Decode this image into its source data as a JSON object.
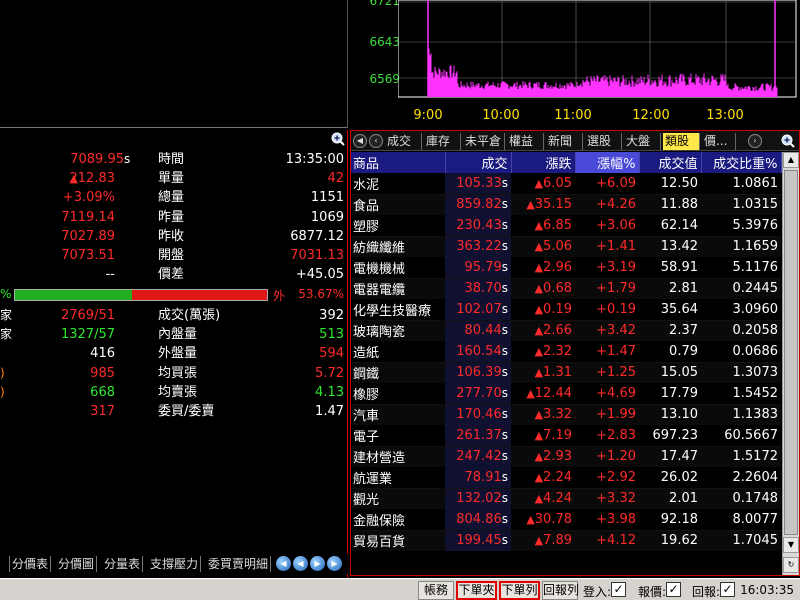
{
  "chart": {
    "y_labels": [
      "6721",
      "6643",
      "6569"
    ],
    "x_labels": [
      "9:00",
      "10:00",
      "11:00",
      "12:00",
      "13:00"
    ],
    "colors": {
      "bars": "#ff33ff",
      "grid": "#777777",
      "axis_text_y": "#3fdc3f",
      "axis_text_x": "#ffe000"
    }
  },
  "quote": {
    "rows": [
      {
        "left": "7089.95",
        "left_suffix": "s",
        "left_color": "red",
        "label": "時間",
        "right": "13:35:00",
        "right_color": "white"
      },
      {
        "left": "212.83",
        "left_prefix": "▲",
        "left_color": "red",
        "label": "單量",
        "right": "42",
        "right_color": "red"
      },
      {
        "left": "+3.09%",
        "left_color": "red",
        "label": "總量",
        "right": "1151",
        "right_color": "white"
      },
      {
        "left": "7119.14",
        "left_color": "red",
        "label": "昨量",
        "right": "1069",
        "right_color": "white"
      },
      {
        "left": "7027.89",
        "left_color": "red",
        "label": "昨收",
        "right": "6877.12",
        "right_color": "white"
      },
      {
        "left": "7073.51",
        "left_color": "red",
        "label": "開盤",
        "right": "7031.13",
        "right_color": "red"
      },
      {
        "left": "--",
        "left_color": "white",
        "label": "價差",
        "right": "+45.05",
        "right_color": "white"
      }
    ],
    "ratio": {
      "left_pct": "%",
      "green_fraction": 0.4633,
      "out_label": "外",
      "right_pct": "53.67%"
    },
    "rows2": [
      {
        "prefix": "家",
        "left": "2769/51",
        "left_color": "red",
        "label": "成交(萬張)",
        "right": "392",
        "right_color": "white"
      },
      {
        "prefix": "家",
        "left": "1327/57",
        "left_color": "green",
        "label": "內盤量",
        "right": "513",
        "right_color": "green"
      },
      {
        "prefix": "",
        "left": "416",
        "left_color": "white",
        "label": "外盤量",
        "right": "594",
        "right_color": "red"
      },
      {
        "prefix": ")",
        "left": "985",
        "left_color": "red",
        "label": "均買張",
        "right": "5.72",
        "right_color": "red"
      },
      {
        "prefix": ")",
        "left": "668",
        "left_color": "green",
        "label": "均賣張",
        "right": "4.13",
        "right_color": "green"
      },
      {
        "prefix": "",
        "left": "317",
        "left_color": "red",
        "label": "委買/委賣",
        "right": "1.47",
        "right_color": "white"
      }
    ],
    "bottom_tabs": [
      "分價表",
      "分價圖",
      "分量表",
      "支撐壓力",
      "委買賣明細"
    ]
  },
  "sector": {
    "tabs": [
      "成交",
      "庫存",
      "未平倉",
      "權益",
      "新聞",
      "選股",
      "大盤",
      "類股",
      "價..."
    ],
    "active_tab": "類股",
    "headers": [
      "商品",
      "成交",
      "漲跌",
      "漲幅%",
      "成交值",
      "成交比重%"
    ],
    "highlight_header": "漲幅%",
    "rows": [
      {
        "name": "水泥",
        "price": "105.33",
        "chg": "6.05",
        "pct": "+6.09",
        "vol": "12.50",
        "ratio": "1.0861"
      },
      {
        "name": "食品",
        "price": "859.82",
        "chg": "35.15",
        "pct": "+4.26",
        "vol": "11.88",
        "ratio": "1.0315"
      },
      {
        "name": "塑膠",
        "price": "230.43",
        "chg": "6.85",
        "pct": "+3.06",
        "vol": "62.14",
        "ratio": "5.3976"
      },
      {
        "name": "紡織纖維",
        "price": "363.22",
        "chg": "5.06",
        "pct": "+1.41",
        "vol": "13.42",
        "ratio": "1.1659"
      },
      {
        "name": "電機機械",
        "price": "95.79",
        "chg": "2.96",
        "pct": "+3.19",
        "vol": "58.91",
        "ratio": "5.1176"
      },
      {
        "name": "電器電纜",
        "price": "38.70",
        "chg": "0.68",
        "pct": "+1.79",
        "vol": "2.81",
        "ratio": "0.2445"
      },
      {
        "name": "化學生技醫療",
        "price": "102.07",
        "chg": "0.19",
        "pct": "+0.19",
        "vol": "35.64",
        "ratio": "3.0960"
      },
      {
        "name": "玻璃陶瓷",
        "price": "80.44",
        "chg": "2.66",
        "pct": "+3.42",
        "vol": "2.37",
        "ratio": "0.2058"
      },
      {
        "name": "造紙",
        "price": "160.54",
        "chg": "2.32",
        "pct": "+1.47",
        "vol": "0.79",
        "ratio": "0.0686"
      },
      {
        "name": "鋼鐵",
        "price": "106.39",
        "chg": "1.31",
        "pct": "+1.25",
        "vol": "15.05",
        "ratio": "1.3073"
      },
      {
        "name": "橡膠",
        "price": "277.70",
        "chg": "12.44",
        "pct": "+4.69",
        "vol": "17.79",
        "ratio": "1.5452"
      },
      {
        "name": "汽車",
        "price": "170.46",
        "chg": "3.32",
        "pct": "+1.99",
        "vol": "13.10",
        "ratio": "1.1383"
      },
      {
        "name": "電子",
        "price": "261.37",
        "chg": "7.19",
        "pct": "+2.83",
        "vol": "697.23",
        "ratio": "60.5667"
      },
      {
        "name": "建材營造",
        "price": "247.42",
        "chg": "2.93",
        "pct": "+1.20",
        "vol": "17.47",
        "ratio": "1.5172"
      },
      {
        "name": "航運業",
        "price": "78.91",
        "chg": "2.24",
        "pct": "+2.92",
        "vol": "26.02",
        "ratio": "2.2604"
      },
      {
        "name": "觀光",
        "price": "132.02",
        "chg": "4.24",
        "pct": "+3.32",
        "vol": "2.01",
        "ratio": "0.1748"
      },
      {
        "name": "金融保險",
        "price": "804.86",
        "chg": "30.78",
        "pct": "+3.98",
        "vol": "92.18",
        "ratio": "8.0077"
      },
      {
        "name": "貿易百貨",
        "price": "199.45",
        "chg": "7.89",
        "pct": "+4.12",
        "vol": "19.62",
        "ratio": "1.7045"
      }
    ],
    "price_suffix": "s",
    "up_glyph": "▲"
  },
  "status_bar": {
    "buttons": [
      "帳務",
      "下單夾",
      "下單列",
      "回報列"
    ],
    "hot_buttons": [
      "下單夾",
      "下單列"
    ],
    "checks": [
      {
        "label": "登入:",
        "checked": "✓"
      },
      {
        "label": "報價:",
        "checked": "✓"
      },
      {
        "label": "回報:",
        "checked": "✓"
      }
    ],
    "clock": "16:03:35"
  }
}
